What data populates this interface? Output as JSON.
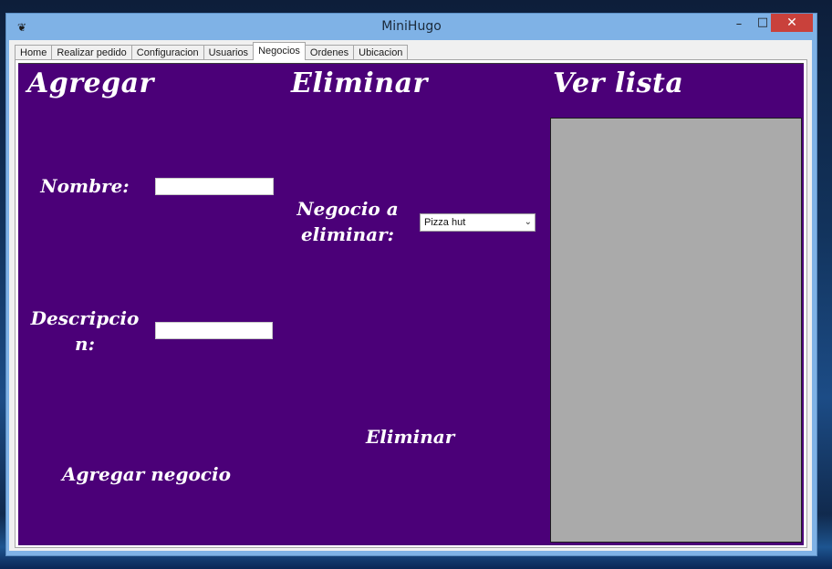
{
  "window": {
    "title": "MiniHugo",
    "icon": "app-icon",
    "controls": {
      "minimize": "–",
      "maximize": "□",
      "close": "✕"
    }
  },
  "tabs": [
    {
      "label": "Home",
      "active": false
    },
    {
      "label": "Realizar pedido",
      "active": false
    },
    {
      "label": "Configuracion",
      "active": false
    },
    {
      "label": "Usuarios",
      "active": false
    },
    {
      "label": "Negocios",
      "active": true
    },
    {
      "label": "Ordenes",
      "active": false
    },
    {
      "label": "Ubicacion",
      "active": false
    }
  ],
  "colors": {
    "panel_background": "#4b0078",
    "list_background": "#aaaaaa",
    "close_button": "#c9413b"
  },
  "agregar": {
    "heading": "Agregar",
    "nombre_label": "Nombre:",
    "nombre_value": "",
    "descripcion_label_1": "Descripcio",
    "descripcion_label_2": "n:",
    "descripcion_value": "",
    "button": "Agregar negocio"
  },
  "eliminar": {
    "heading": "Eliminar",
    "negocio_label_1": "Negocio a",
    "negocio_label_2": "eliminar:",
    "selected": "Pizza hut",
    "button": "Eliminar"
  },
  "ver_lista": {
    "heading": "Ver lista"
  }
}
